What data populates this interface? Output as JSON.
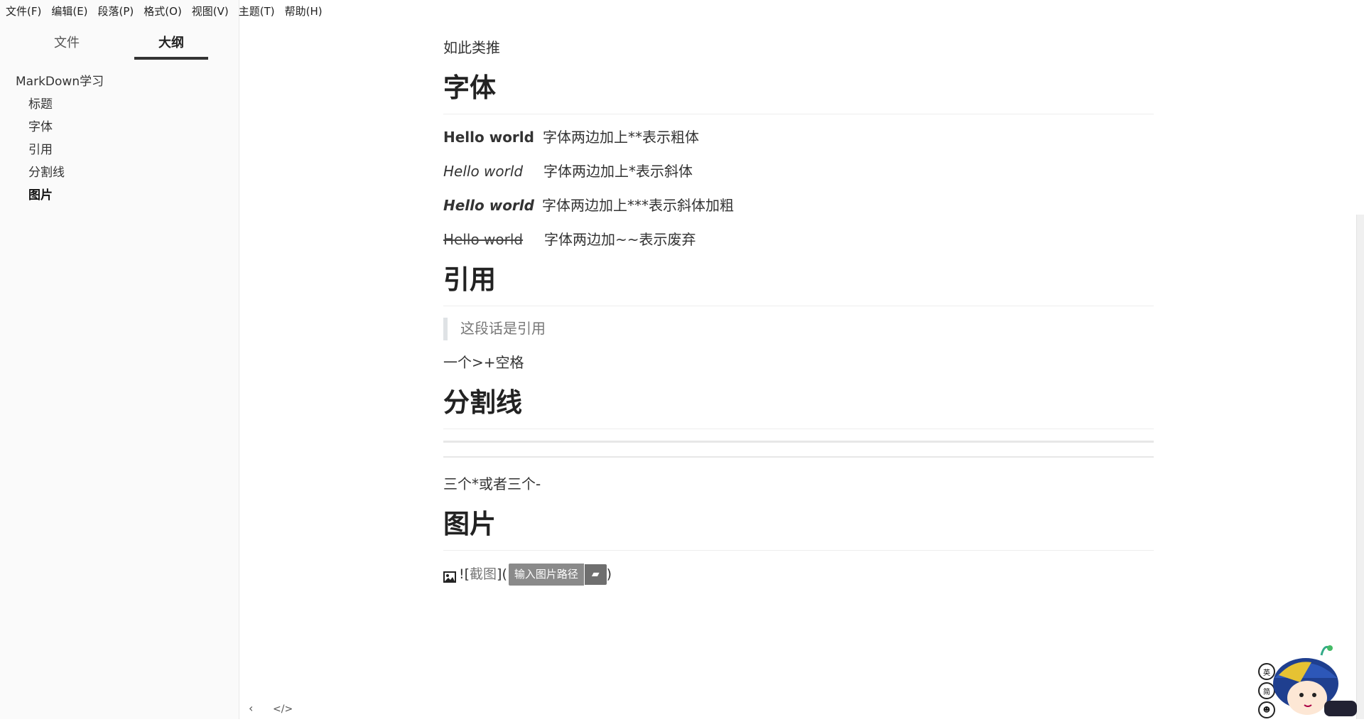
{
  "menu": [
    "文件(F)",
    "编辑(E)",
    "段落(P)",
    "格式(O)",
    "视图(V)",
    "主题(T)",
    "帮助(H)"
  ],
  "sidebar": {
    "tabs": [
      "文件",
      "大纲"
    ],
    "outline": [
      "MarkDown学习",
      "标题",
      "字体",
      "引用",
      "分割线",
      "图片"
    ]
  },
  "editor": {
    "top_partial": "如此类推",
    "font_heading": "字体",
    "font_rows": [
      {
        "sample": "Hello world",
        "note": "字体两边加上**表示粗体"
      },
      {
        "sample": "Hello world",
        "note": "字体两边加上*表示斜体"
      },
      {
        "sample": "Hello world",
        "note": "字体两边加上***表示斜体加粗"
      },
      {
        "sample": "Hello world",
        "note": "字体两边加~~表示废弃"
      }
    ],
    "quote_heading": "引用",
    "quote_text": "这段话是引用",
    "quote_note": "一个>+空格",
    "hr_heading": "分割线",
    "hr_note": "三个*或者三个-",
    "img_heading": "图片",
    "img_prefix": "![",
    "img_alt": "截图",
    "img_mid": "](",
    "img_input_placeholder": "输入图片路径",
    "img_suffix": ")"
  },
  "ime_badges": [
    "英",
    "简",
    "☻"
  ]
}
